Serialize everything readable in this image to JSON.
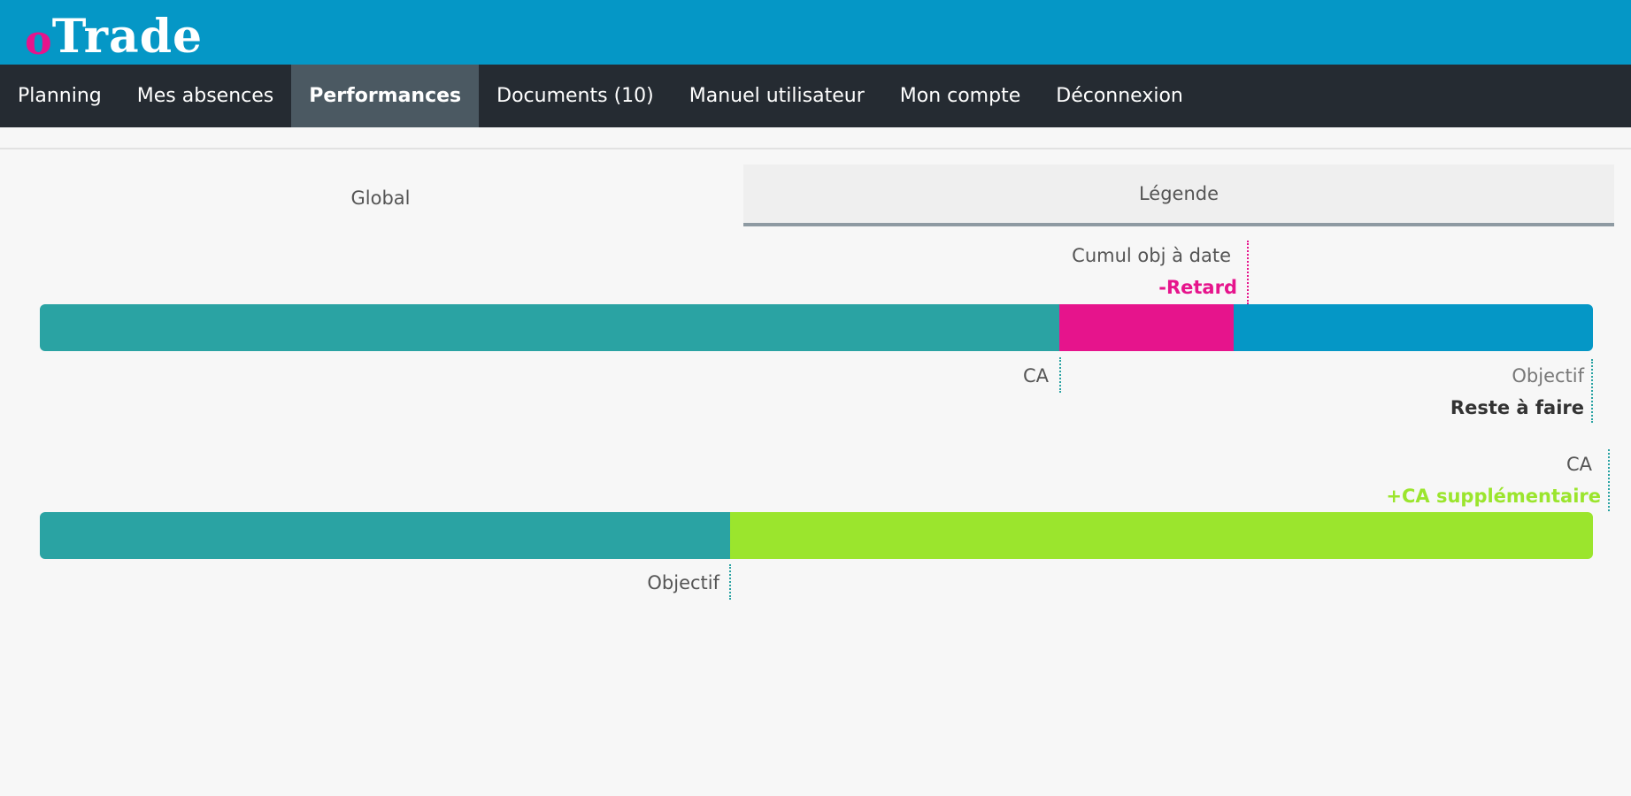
{
  "app": {
    "logo_o": "o",
    "logo_rest": "Trade"
  },
  "nav": {
    "items": [
      {
        "label": "Planning"
      },
      {
        "label": "Mes absences"
      },
      {
        "label": "Performances"
      },
      {
        "label": "Documents (10)"
      },
      {
        "label": "Manuel utilisateur"
      },
      {
        "label": "Mon compte"
      },
      {
        "label": "Déconnexion"
      }
    ],
    "active": "Performances"
  },
  "tabs": {
    "global": "Global",
    "legende": "Légende"
  },
  "legend1": {
    "cumul_label": "Cumul obj à date",
    "retard_label": "-Retard",
    "ca_label": "CA",
    "objectif_label": "Objectif",
    "reste_label": "Reste à faire",
    "ca_fraction": 0.658,
    "cumul_fraction": 0.77
  },
  "legend2": {
    "ca_label": "CA",
    "supplement_label": "+CA supplémentaire",
    "objectif_label": "Objectif",
    "objectif_fraction": 0.444
  },
  "colors": {
    "ca": "#2aa3a3",
    "retard": "#e6148c",
    "reste": "#0597c6",
    "supplement": "#9be52d",
    "header": "#0597c6",
    "nav": "#252b32"
  }
}
